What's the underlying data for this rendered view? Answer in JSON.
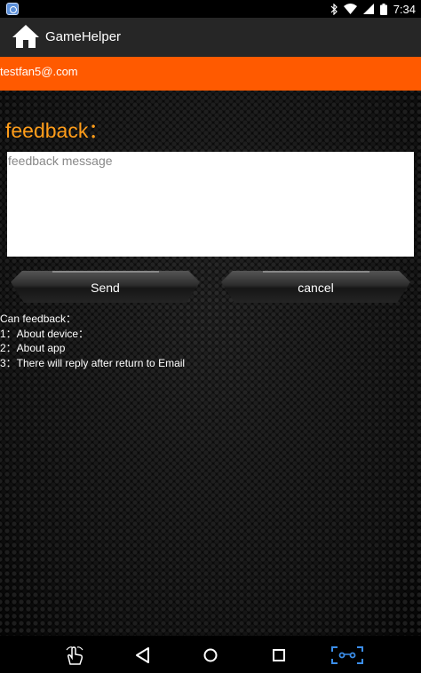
{
  "status_bar": {
    "time": "7:34",
    "icons": [
      "app-notification-icon",
      "bluetooth-icon",
      "wifi-icon",
      "cellular-icon",
      "battery-icon"
    ]
  },
  "action_bar": {
    "title": "GameHelper",
    "home_icon": "home-icon"
  },
  "account": {
    "email": "testfan5@.com"
  },
  "feedback": {
    "heading": "feedback：",
    "placeholder": "feedback message",
    "value": ""
  },
  "buttons": {
    "send": "Send",
    "cancel": "cancel"
  },
  "info": {
    "lines": [
      "Can feedback：",
      "1：About device：",
      "2：About app",
      "3：There will reply after return to Email"
    ]
  },
  "nav_bar": {
    "icons": [
      "hand-gesture-icon",
      "back-icon",
      "home-circle-icon",
      "recents-icon",
      "screenshot-icon"
    ]
  },
  "colors": {
    "accent_orange": "#ff5a00",
    "heading_orange": "#ff9d1a",
    "action_bar": "#262626",
    "nav_highlight": "#3b8eea"
  }
}
